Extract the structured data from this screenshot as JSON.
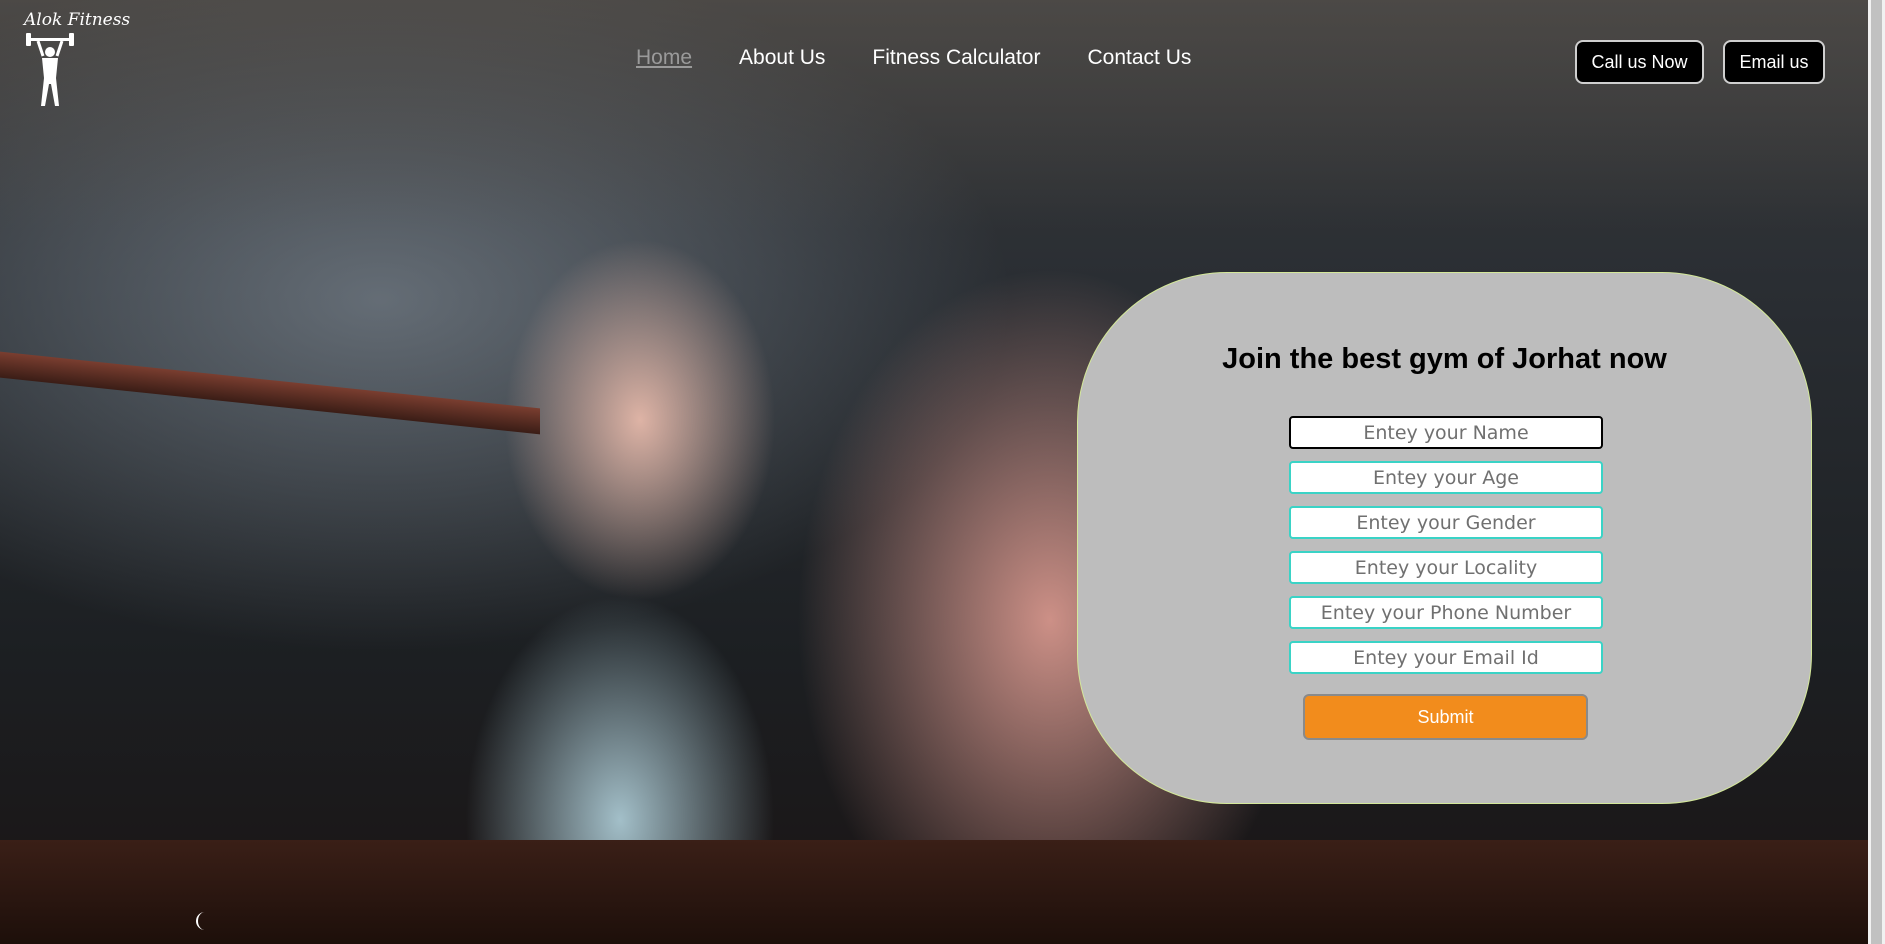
{
  "logo": {
    "text": "Alok Fitness",
    "icon": "weightlifter-icon"
  },
  "nav": {
    "items": [
      {
        "label": "Home",
        "active": true
      },
      {
        "label": "About Us",
        "active": false
      },
      {
        "label": "Fitness Calculator",
        "active": false
      },
      {
        "label": "Contact Us",
        "active": false
      }
    ]
  },
  "header_buttons": {
    "call_label": "Call us Now",
    "email_label": "Email us"
  },
  "form": {
    "title": "Join the best gym of Jorhat now",
    "fields": [
      {
        "placeholder": "Entey your Name",
        "focused": true
      },
      {
        "placeholder": "Entey your Age",
        "focused": false
      },
      {
        "placeholder": "Entey your Gender",
        "focused": false
      },
      {
        "placeholder": "Entey your Locality",
        "focused": false
      },
      {
        "placeholder": "Entey your Phone Number",
        "focused": false
      },
      {
        "placeholder": "Entey your Email Id",
        "focused": false
      }
    ],
    "submit_label": "Submit"
  },
  "colors": {
    "form_bg": "#bdbdbd",
    "field_border": "#3ad3c6",
    "submit_bg": "#f28c1c",
    "card_border": "#d4e89a"
  }
}
